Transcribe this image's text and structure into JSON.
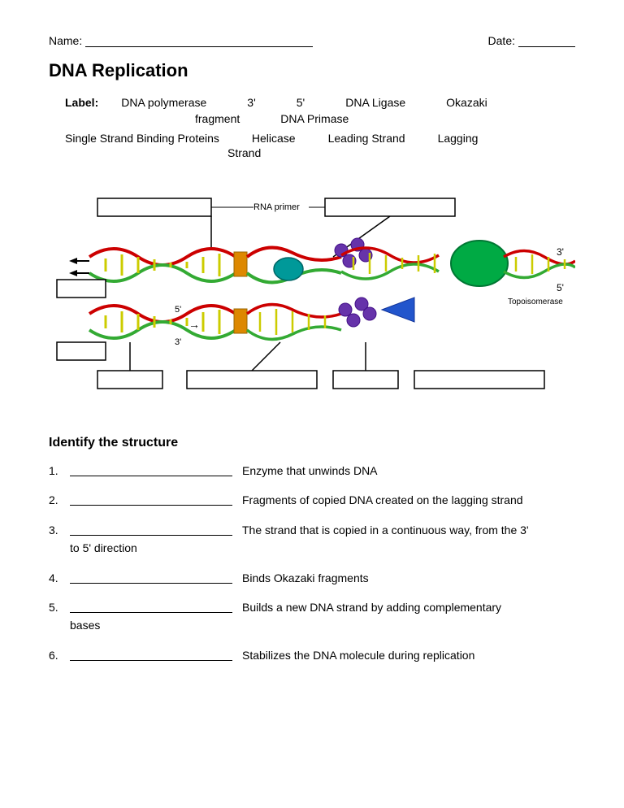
{
  "header": {
    "name_label": "Name:",
    "date_label": "Date:"
  },
  "title": "DNA Replication",
  "label_section": {
    "bold": "Label:",
    "row1": [
      "DNA polymerase",
      "3'",
      "5'",
      "DNA Ligase",
      "Okazaki"
    ],
    "row2": [
      "fragment",
      "DNA Primase"
    ],
    "row3": [
      "Single Strand Binding Proteins",
      "Helicase",
      "Leading Strand",
      "Lagging"
    ],
    "row4": [
      "Strand"
    ]
  },
  "diagram": {
    "rna_primer_label": "RNA primer",
    "topoisomerase_label": "Topoisomerase",
    "label_boxes": [
      {
        "id": "box1",
        "text": ""
      },
      {
        "id": "box2",
        "text": ""
      },
      {
        "id": "box3",
        "text": ""
      },
      {
        "id": "box4",
        "text": ""
      },
      {
        "id": "box5",
        "text": ""
      },
      {
        "id": "box6",
        "text": ""
      },
      {
        "id": "box7",
        "text": ""
      },
      {
        "id": "box8",
        "text": ""
      }
    ],
    "three_prime": "3'",
    "five_prime": "5'"
  },
  "identify_section": {
    "heading": "Identify the structure",
    "questions": [
      {
        "num": "1.",
        "text": "Enzyme that unwinds DNA"
      },
      {
        "num": "2.",
        "text": "Fragments of copied DNA created on the lagging strand"
      },
      {
        "num": "3.",
        "text": "The strand that is copied in a continuous way, from the 3' to 5' direction"
      },
      {
        "num": "4.",
        "text": "Binds Okazaki fragments"
      },
      {
        "num": "5.",
        "text": "Builds a new DNA strand by adding complementary bases"
      },
      {
        "num": "6.",
        "text": "Stabilizes the DNA molecule during replication"
      }
    ]
  }
}
